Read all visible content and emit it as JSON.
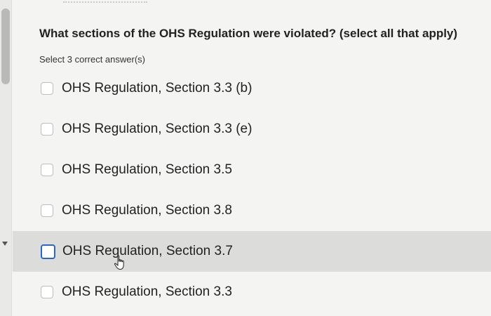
{
  "question": {
    "text": "What sections of the OHS Regulation were violated? (select all that apply)",
    "instruction": "Select 3 correct answer(s)"
  },
  "options": [
    {
      "label": "OHS Regulation, Section 3.3  (b)",
      "checked": false,
      "hovered": false
    },
    {
      "label": "OHS Regulation, Section 3.3  (e)",
      "checked": false,
      "hovered": false
    },
    {
      "label": "OHS Regulation, Section 3.5",
      "checked": false,
      "hovered": false
    },
    {
      "label": "OHS Regulation, Section 3.8",
      "checked": false,
      "hovered": false
    },
    {
      "label": "OHS Regulation, Section 3.7",
      "checked": false,
      "hovered": true
    },
    {
      "label": "OHS Regulation, Section 3.3",
      "checked": false,
      "hovered": false
    }
  ],
  "colors": {
    "background": "#f4f4f3",
    "hover_row": "#dcdcdb",
    "focus_checkbox": "#2a66c8"
  },
  "icons": {
    "cursor": "hand-pointer-icon",
    "scroll_arrow": "chevron-down-icon"
  }
}
